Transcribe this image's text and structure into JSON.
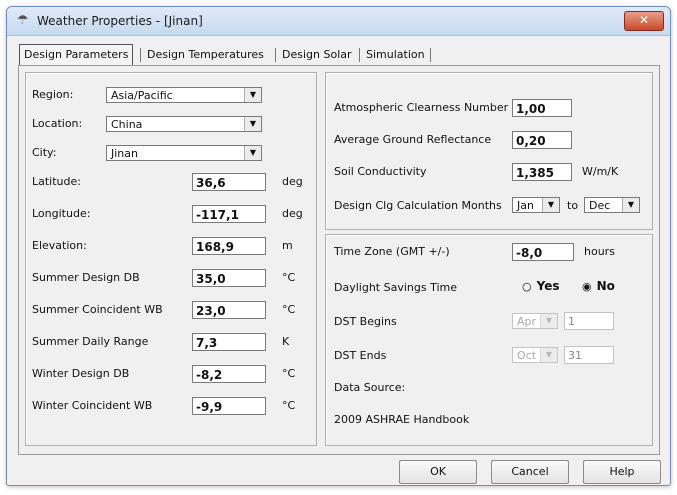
{
  "window": {
    "title": "Weather Properties - [Jinan]",
    "close_label": "✕"
  },
  "tabs": [
    {
      "label": "Design Parameters"
    },
    {
      "label": "Design Temperatures"
    },
    {
      "label": "Design Solar"
    },
    {
      "label": "Simulation"
    }
  ],
  "left": {
    "region_label": "Region:",
    "region_value": "Asia/Pacific",
    "location_label": "Location:",
    "location_value": "China",
    "city_label": "City:",
    "city_value": "Jinan",
    "latitude_label": "Latitude:",
    "latitude_value": "36,6",
    "latitude_unit": "deg",
    "longitude_label": "Longitude:",
    "longitude_value": "-117,1",
    "longitude_unit": "deg",
    "elevation_label": "Elevation:",
    "elevation_value": "168,9",
    "elevation_unit": "m",
    "summer_db_label": "Summer Design DB",
    "summer_db_value": "35,0",
    "summer_db_unit": "°C",
    "summer_wb_label": "Summer Coincident WB",
    "summer_wb_value": "23,0",
    "summer_wb_unit": "°C",
    "daily_range_label": "Summer Daily Range",
    "daily_range_value": "7,3",
    "daily_range_unit": "K",
    "winter_db_label": "Winter Design DB",
    "winter_db_value": "-8,2",
    "winter_db_unit": "°C",
    "winter_wb_label": "Winter Coincident WB",
    "winter_wb_value": "-9,9",
    "winter_wb_unit": "°C"
  },
  "right_top": {
    "clearness_label": "Atmospheric Clearness Number",
    "clearness_value": "1,00",
    "reflectance_label": "Average Ground Reflectance",
    "reflectance_value": "0,20",
    "soil_label": "Soil Conductivity",
    "soil_value": "1,385",
    "soil_unit": "W/m/K",
    "clg_months_label": "Design Clg Calculation Months",
    "clg_from": "Jan",
    "to_label": "to",
    "clg_to": "Dec"
  },
  "right_bottom": {
    "timezone_label": "Time Zone (GMT +/-)",
    "timezone_value": "-8,0",
    "timezone_unit": "hours",
    "dst_label": "Daylight Savings Time",
    "yes_label": "Yes",
    "no_label": "No",
    "dst_begins_label": "DST Begins",
    "dst_begins_month": "Apr",
    "dst_begins_day": "1",
    "dst_ends_label": "DST Ends",
    "dst_ends_month": "Oct",
    "dst_ends_day": "31",
    "data_source_label": "Data Source:",
    "data_source_value": "2009 ASHRAE Handbook"
  },
  "buttons": {
    "ok": "OK",
    "cancel": "Cancel",
    "help": "Help"
  }
}
